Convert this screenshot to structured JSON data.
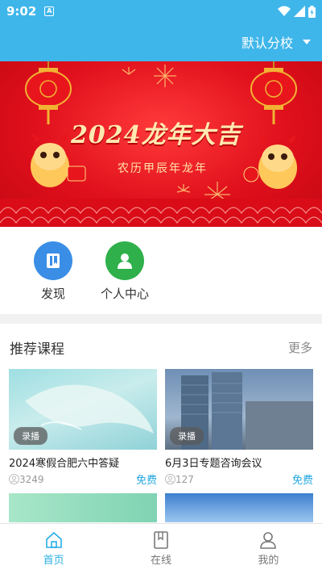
{
  "status_bar": {
    "time": "9:02",
    "notification_icon": "A"
  },
  "header": {
    "campus_selector": "默认分校"
  },
  "banner": {
    "headline": "2024龙年大吉",
    "subline": "农历甲辰年龙年"
  },
  "quick_nav": [
    {
      "label": "发现",
      "icon": "book-icon",
      "color": "#3a8ee6"
    },
    {
      "label": "个人中心",
      "icon": "user-icon",
      "color": "#2fb04a"
    }
  ],
  "section": {
    "title": "推荐课程",
    "more": "更多"
  },
  "courses": [
    {
      "tag": "录播",
      "title": "2024寒假合肥六中答疑",
      "views": "3249",
      "price": "免费"
    },
    {
      "tag": "录播",
      "title": "6月3日专题咨询会议",
      "views": "127",
      "price": "免费"
    }
  ],
  "bottom_nav": [
    {
      "label": "首页",
      "icon": "home-icon",
      "active": true
    },
    {
      "label": "在线",
      "icon": "book-outline-icon",
      "active": false
    },
    {
      "label": "我的",
      "icon": "person-outline-icon",
      "active": false
    }
  ],
  "colors": {
    "accent": "#3fb6ea",
    "price": "#22a7e0",
    "banner_red": "#e0101c"
  }
}
